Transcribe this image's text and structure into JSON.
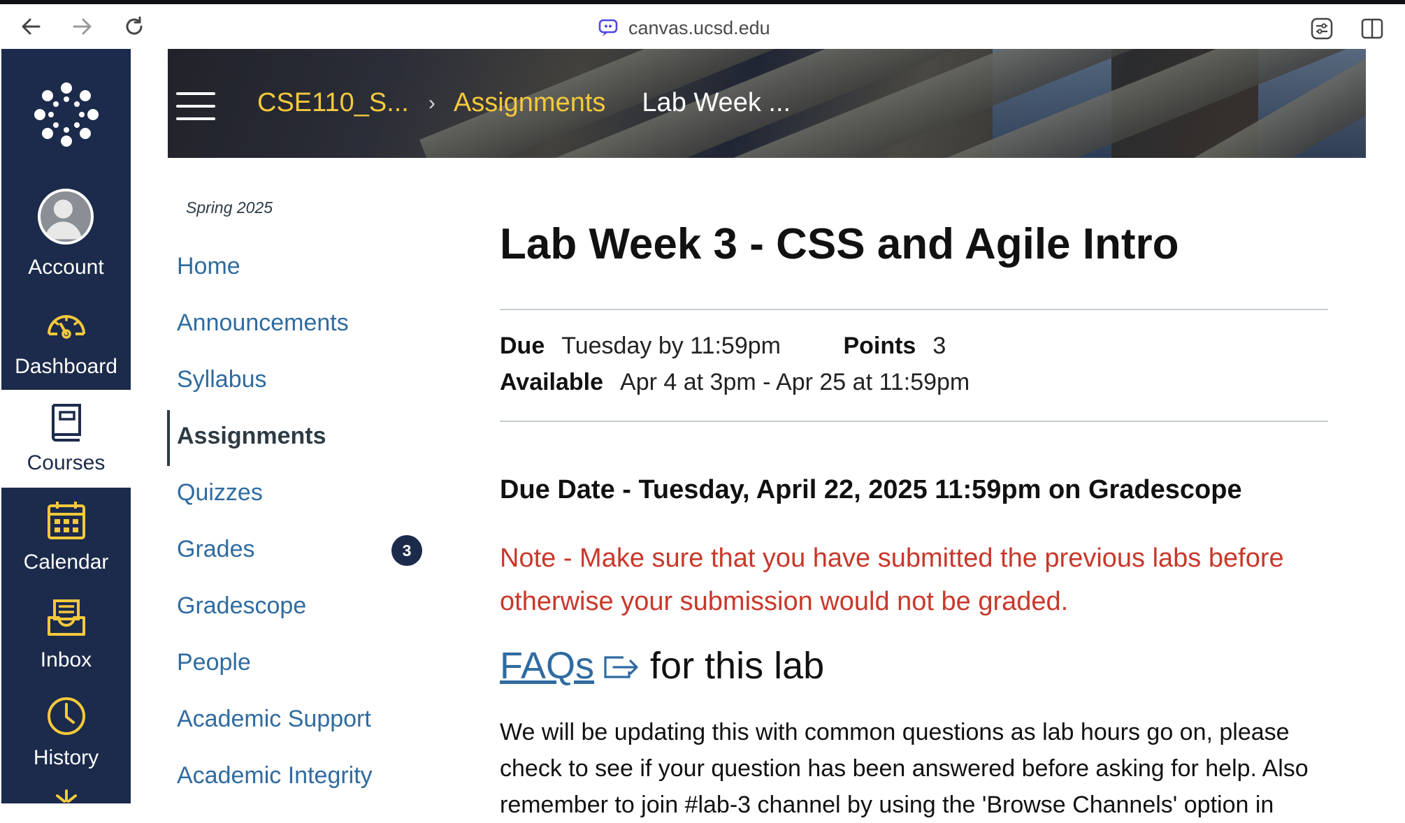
{
  "browser": {
    "url": "canvas.ucsd.edu"
  },
  "global_nav": {
    "items": [
      {
        "label": "Account",
        "icon": "avatar-icon"
      },
      {
        "label": "Dashboard",
        "icon": "dashboard-icon"
      },
      {
        "label": "Courses",
        "icon": "courses-icon",
        "active": true
      },
      {
        "label": "Calendar",
        "icon": "calendar-icon"
      },
      {
        "label": "Inbox",
        "icon": "inbox-icon"
      },
      {
        "label": "History",
        "icon": "history-icon"
      }
    ],
    "accent": "#f5c93c",
    "background": "#1c2b4b"
  },
  "breadcrumb": {
    "course": "CSE110_S...",
    "section": "Assignments",
    "current": "Lab Week ..."
  },
  "course_nav": {
    "term": "Spring 2025",
    "items": [
      {
        "label": "Home"
      },
      {
        "label": "Announcements"
      },
      {
        "label": "Syllabus"
      },
      {
        "label": "Assignments",
        "active": true
      },
      {
        "label": "Quizzes"
      },
      {
        "label": "Grades",
        "badge": "3"
      },
      {
        "label": "Gradescope"
      },
      {
        "label": "People"
      },
      {
        "label": "Academic Support"
      },
      {
        "label": "Academic Integrity"
      }
    ]
  },
  "assignment": {
    "title": "Lab Week 3 - CSS and Agile Intro",
    "due_label": "Due",
    "due_value": "Tuesday by 11:59pm",
    "points_label": "Points",
    "points_value": "3",
    "available_label": "Available",
    "available_value": "Apr 4 at 3pm - Apr 25 at 11:59pm",
    "due_date_heading": "Due Date - Tuesday, April 22, 2025 11:59pm on Gradescope",
    "note": "Note - Make sure that you have submitted the previous labs before otherwise your submission would not be graded.",
    "faq_link": "FAQs",
    "faq_suffix": "for this lab",
    "paragraph": "We will be updating this with common questions as lab hours go on, please check to see if your question has been answered before asking for help. Also remember to join #lab-3 channel by using the 'Browse Channels' option in"
  }
}
